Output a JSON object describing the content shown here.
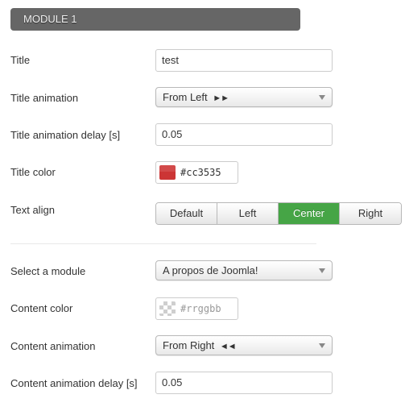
{
  "module": {
    "header": "MODULE 1"
  },
  "fields": {
    "title": {
      "label": "Title",
      "value": "test"
    },
    "title_animation": {
      "label": "Title animation",
      "value": "From Left",
      "arrows": "►►"
    },
    "title_animation_delay": {
      "label": "Title animation delay [s]",
      "value": "0.05"
    },
    "title_color": {
      "label": "Title color",
      "value": "#cc3535",
      "swatch_color": "#cc3535"
    },
    "text_align": {
      "label": "Text align",
      "options": [
        "Default",
        "Left",
        "Center",
        "Right"
      ],
      "selected": "Center",
      "active_color": "#46a546"
    },
    "select_module": {
      "label": "Select a module",
      "value": "A propos de Joomla!"
    },
    "content_color": {
      "label": "Content color",
      "value": "",
      "placeholder": "#rrggbb"
    },
    "content_animation": {
      "label": "Content animation",
      "value": "From Right",
      "arrows": "◄◄"
    },
    "content_animation_delay": {
      "label": "Content animation delay [s]",
      "value": "0.05"
    }
  }
}
